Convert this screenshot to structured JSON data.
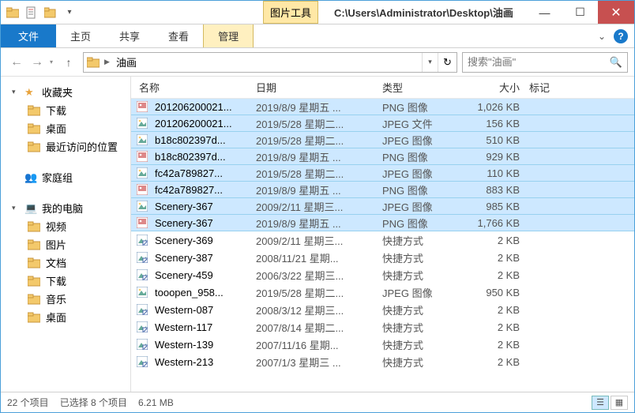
{
  "title_path": "C:\\Users\\Administrator\\Desktop\\油画",
  "contextual_tab": "图片工具",
  "ribbon": {
    "file": "文件",
    "home": "主页",
    "share": "共享",
    "view": "查看",
    "manage": "管理"
  },
  "address": {
    "crumb": "油画"
  },
  "search": {
    "placeholder": "搜索\"油画\""
  },
  "sidebar": {
    "favorites": {
      "label": "收藏夹",
      "items": [
        "下载",
        "桌面",
        "最近访问的位置"
      ]
    },
    "homegroup": {
      "label": "家庭组"
    },
    "computer": {
      "label": "我的电脑",
      "items": [
        "视频",
        "图片",
        "文档",
        "下载",
        "音乐",
        "桌面"
      ]
    }
  },
  "columns": {
    "name": "名称",
    "date": "日期",
    "type": "类型",
    "size": "大小",
    "tag": "标记"
  },
  "files": [
    {
      "sel": true,
      "icon": "png",
      "name": "201206200021...",
      "date": "2019/8/9 星期五 ...",
      "type": "PNG 图像",
      "size": "1,026 KB"
    },
    {
      "sel": true,
      "icon": "jpg",
      "name": "201206200021...",
      "date": "2019/5/28 星期二...",
      "type": "JPEG 文件",
      "size": "156 KB"
    },
    {
      "sel": true,
      "icon": "jpg",
      "name": "b18c802397d...",
      "date": "2019/5/28 星期二...",
      "type": "JPEG 图像",
      "size": "510 KB"
    },
    {
      "sel": true,
      "icon": "png",
      "name": "b18c802397d...",
      "date": "2019/8/9 星期五 ...",
      "type": "PNG 图像",
      "size": "929 KB"
    },
    {
      "sel": true,
      "icon": "jpg",
      "name": "fc42a789827...",
      "date": "2019/5/28 星期二...",
      "type": "JPEG 图像",
      "size": "110 KB"
    },
    {
      "sel": true,
      "icon": "png",
      "name": "fc42a789827...",
      "date": "2019/8/9 星期五 ...",
      "type": "PNG 图像",
      "size": "883 KB"
    },
    {
      "sel": true,
      "icon": "jpg",
      "name": "Scenery-367",
      "date": "2009/2/11 星期三...",
      "type": "JPEG 图像",
      "size": "985 KB"
    },
    {
      "sel": true,
      "icon": "png",
      "name": "Scenery-367",
      "date": "2019/8/9 星期五 ...",
      "type": "PNG 图像",
      "size": "1,766 KB"
    },
    {
      "sel": false,
      "icon": "lnk",
      "name": "Scenery-369",
      "date": "2009/2/11 星期三...",
      "type": "快捷方式",
      "size": "2 KB"
    },
    {
      "sel": false,
      "icon": "lnk",
      "name": "Scenery-387",
      "date": "2008/11/21 星期...",
      "type": "快捷方式",
      "size": "2 KB"
    },
    {
      "sel": false,
      "icon": "lnk",
      "name": "Scenery-459",
      "date": "2006/3/22 星期三...",
      "type": "快捷方式",
      "size": "2 KB"
    },
    {
      "sel": false,
      "icon": "jpg",
      "name": "tooopen_958...",
      "date": "2019/5/28 星期二...",
      "type": "JPEG 图像",
      "size": "950 KB"
    },
    {
      "sel": false,
      "icon": "lnk",
      "name": "Western-087",
      "date": "2008/3/12 星期三...",
      "type": "快捷方式",
      "size": "2 KB"
    },
    {
      "sel": false,
      "icon": "lnk",
      "name": "Western-117",
      "date": "2007/8/14 星期二...",
      "type": "快捷方式",
      "size": "2 KB"
    },
    {
      "sel": false,
      "icon": "lnk",
      "name": "Western-139",
      "date": "2007/11/16 星期...",
      "type": "快捷方式",
      "size": "2 KB"
    },
    {
      "sel": false,
      "icon": "lnk",
      "name": "Western-213",
      "date": "2007/1/3 星期三 ...",
      "type": "快捷方式",
      "size": "2 KB"
    }
  ],
  "status": {
    "count": "22 个项目",
    "selected": "已选择 8 个项目",
    "size": "6.21 MB"
  }
}
